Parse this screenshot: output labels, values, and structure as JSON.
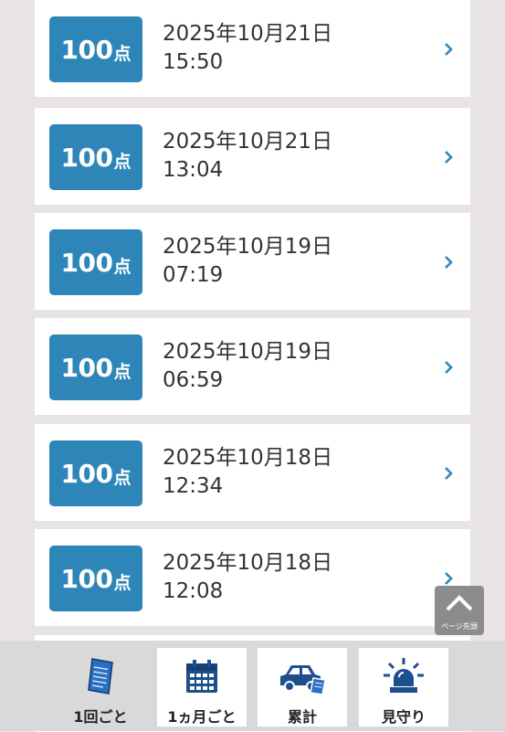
{
  "entries": [
    {
      "score": "100",
      "unit": "点",
      "date": "2025年10月21日",
      "time": "15:50"
    },
    {
      "score": "100",
      "unit": "点",
      "date": "2025年10月21日",
      "time": "13:04"
    },
    {
      "score": "100",
      "unit": "点",
      "date": "2025年10月19日",
      "time": "07:19"
    },
    {
      "score": "100",
      "unit": "点",
      "date": "2025年10月19日",
      "time": "06:59"
    },
    {
      "score": "100",
      "unit": "点",
      "date": "2025年10月18日",
      "time": "12:34"
    },
    {
      "score": "100",
      "unit": "点",
      "date": "2025年10月18日",
      "time": "12:08"
    }
  ],
  "page_top_label": "ページ先頭",
  "nav": [
    {
      "label": "1回ごと",
      "icon": "document-icon",
      "active": true
    },
    {
      "label": "1ヵ月ごと",
      "icon": "calendar-icon",
      "active": false
    },
    {
      "label": "累計",
      "icon": "car-icon",
      "active": false
    },
    {
      "label": "見守り",
      "icon": "siren-icon",
      "active": false
    }
  ],
  "colors": {
    "accent": "#2e86b8",
    "background": "#e8e4e6",
    "chevron": "#2e86b8",
    "nav_icon": "#1d4f8f"
  }
}
